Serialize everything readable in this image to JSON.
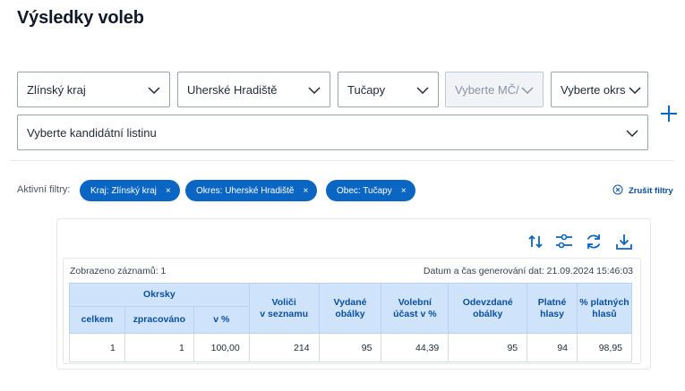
{
  "page": {
    "title": "Výsledky voleb"
  },
  "selects": {
    "kraj": "Zlínský kraj",
    "okres": "Uherské Hradiště",
    "obec": "Tučapy",
    "mc": "Vyberte MČ/",
    "okrsek": "Vyberte okrs",
    "listina": "Vyberte kandidátní listinu"
  },
  "filters": {
    "label": "Aktivní filtry:",
    "chips": [
      "Kraj: Zlínský kraj",
      "Okres: Uherské Hradiště",
      "Obec: Tučapy"
    ],
    "chip_close": "×",
    "clear": "Zrušit filtry"
  },
  "results": {
    "shown": "Zobrazeno záznamů: 1",
    "generated": "Datum a čas generování dat: 21.09.2024 15:46:03",
    "headers": {
      "okrsky": "Okrsky",
      "celkem": "celkem",
      "zpracovano": "zpracováno",
      "pct": "v %",
      "volici_1": "Voliči",
      "volici_2": "v seznamu",
      "vydane_1": "Vydané",
      "vydane_2": "obálky",
      "ucast_1": "Volební",
      "ucast_2": "účast v %",
      "odevzdane_1": "Odevzdané",
      "odevzdane_2": "obálky",
      "platne_1": "Platné",
      "platne_2": "hlasy",
      "pplatnych_1": "% platných",
      "pplatnych_2": "hlasů"
    },
    "row": [
      "1",
      "1",
      "100,00",
      "214",
      "95",
      "44,39",
      "95",
      "94",
      "98,95"
    ]
  },
  "colors": {
    "accent": "#0a66c2",
    "header_bg": "#cfe4fb",
    "header_text": "#0a4ea1"
  },
  "icons": [
    "chevron-down-icon",
    "plus-icon",
    "sort-icon",
    "filter-settings-icon",
    "refresh-icon",
    "download-icon",
    "close-circle-icon"
  ]
}
